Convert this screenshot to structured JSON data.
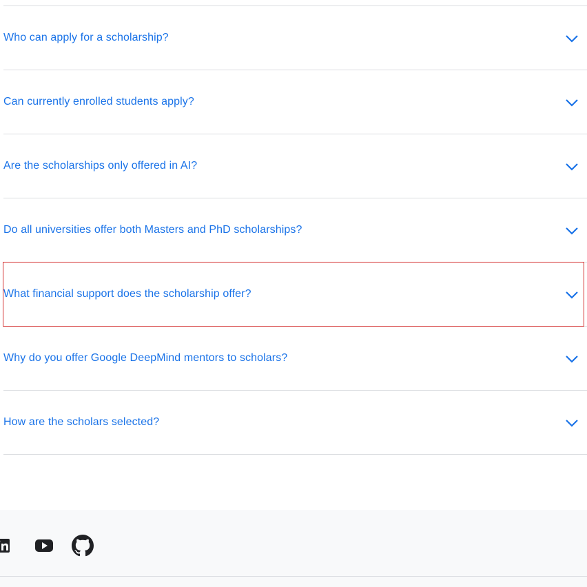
{
  "faq": {
    "items": [
      {
        "question": "Who can apply for a scholarship?"
      },
      {
        "question": "Can currently enrolled students apply?"
      },
      {
        "question": "Are the scholarships only offered in AI?"
      },
      {
        "question": "Do all universities offer both Masters and PhD scholarships?"
      },
      {
        "question": "What financial support does the scholarship offer?"
      },
      {
        "question": "Why do you offer Google DeepMind mentors to scholars?"
      },
      {
        "question": "How are the scholars selected?"
      }
    ],
    "accent_color": "#1a73e8",
    "highlight_color": "#d32f2f"
  },
  "footer": {
    "social_icons": [
      "linkedin-icon",
      "youtube-icon",
      "github-icon"
    ]
  }
}
